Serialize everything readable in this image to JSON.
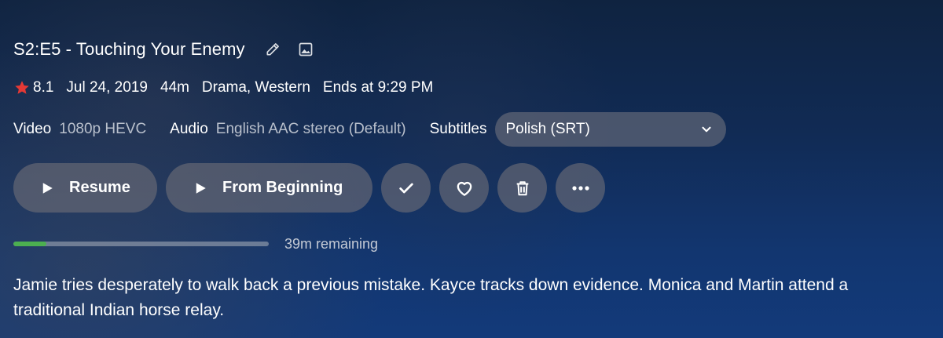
{
  "episode": {
    "title": "S2:E5 - Touching Your Enemy",
    "rating": "8.1",
    "air_date": "Jul 24, 2019",
    "runtime": "44m",
    "genres": "Drama, Western",
    "ends_at": "Ends at 9:29 PM",
    "overview": "Jamie tries desperately to walk back a previous mistake. Kayce tracks down evidence. Monica and Martin attend a traditional Indian horse relay."
  },
  "icons": {
    "edit": "pencil-icon",
    "image": "image-icon",
    "rating": "star-icon",
    "dropdown": "chevron-down-icon"
  },
  "media": {
    "video_label": "Video",
    "video_value": "1080p HEVC",
    "audio_label": "Audio",
    "audio_value": "English AAC stereo (Default)",
    "subtitles_label": "Subtitles",
    "subtitles_value": "Polish (SRT)"
  },
  "actions": {
    "resume_label": "Resume",
    "from_beginning_label": "From Beginning"
  },
  "progress": {
    "fraction": 0.13,
    "remaining_text": "39m remaining"
  },
  "colors": {
    "star": "#e53935",
    "progress_fill": "#4caf50",
    "background": "#123670"
  }
}
